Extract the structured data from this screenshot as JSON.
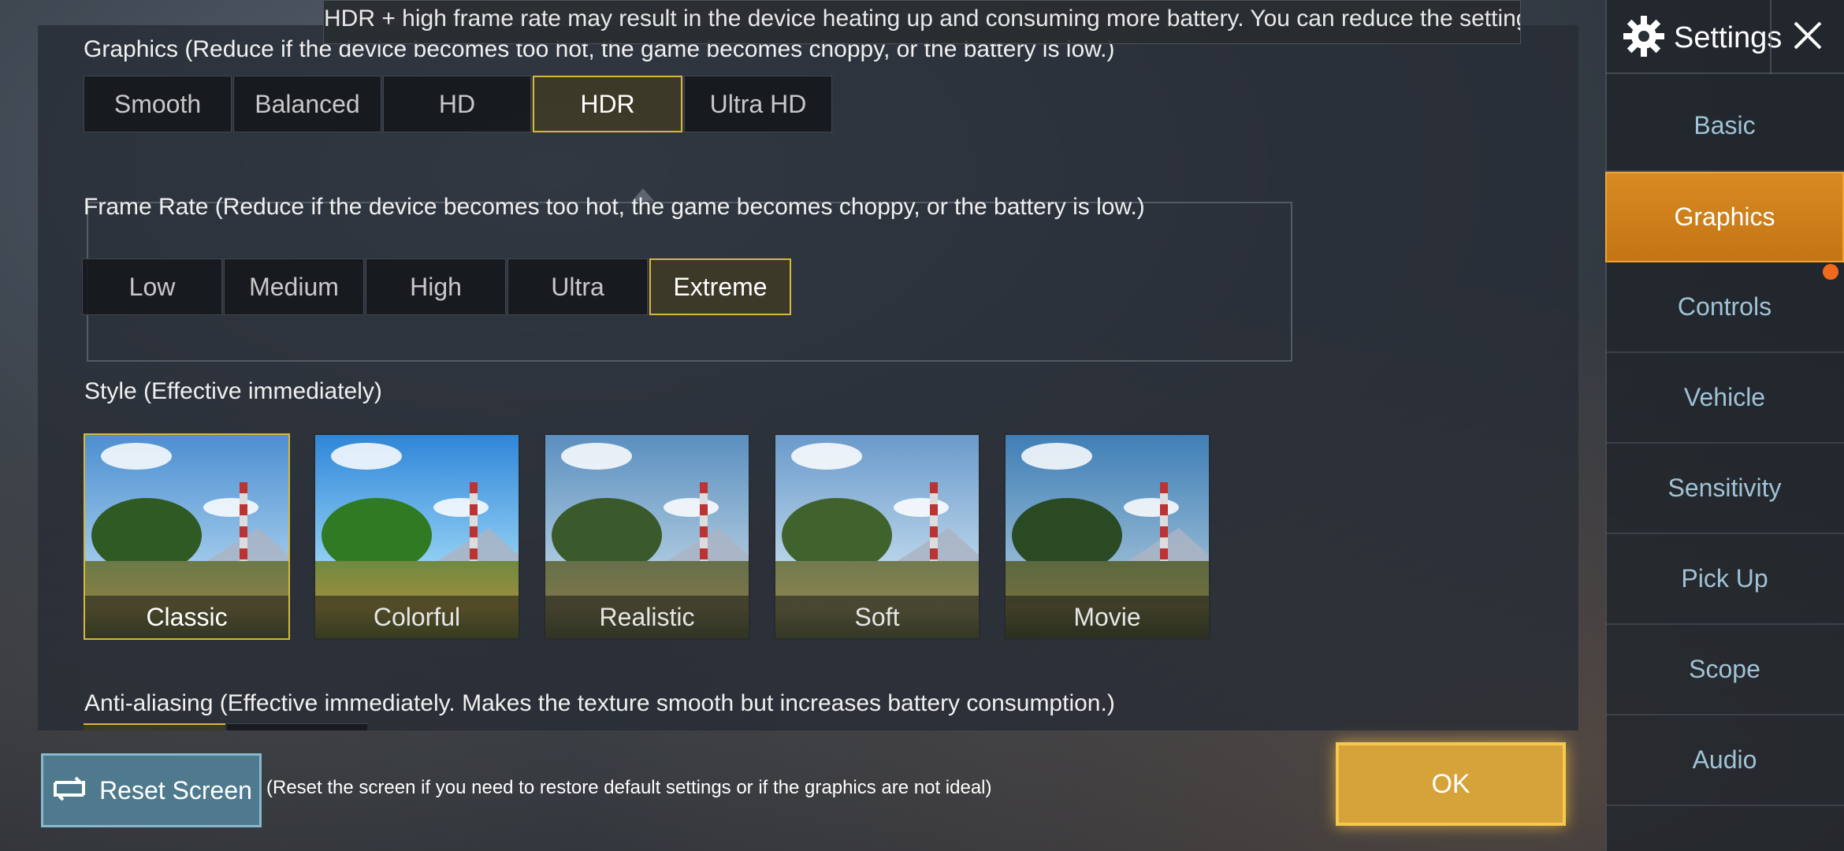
{
  "tooltip": "HDR + high frame rate may result in the device heating up and consuming more battery. You can reduce the settings accordingly.",
  "graphics": {
    "label": "Graphics (Reduce if the device becomes too hot, the game becomes choppy, or the battery is low.)",
    "options": [
      "Smooth",
      "Balanced",
      "HD",
      "HDR",
      "Ultra HD"
    ],
    "selected": "HDR"
  },
  "frame_rate": {
    "label": "Frame Rate (Reduce if the device becomes too hot, the game becomes choppy, or the battery is low.)",
    "options": [
      "Low",
      "Medium",
      "High",
      "Ultra",
      "Extreme"
    ],
    "selected": "Extreme"
  },
  "style": {
    "label": "Style (Effective immediately)",
    "options": [
      "Classic",
      "Colorful",
      "Realistic",
      "Soft",
      "Movie"
    ],
    "selected": "Classic"
  },
  "anti_aliasing": {
    "label": "Anti-aliasing (Effective immediately. Makes the texture smooth but increases battery consumption.)"
  },
  "bottom": {
    "reset_label": "Reset Screen",
    "reset_note": "(Reset the screen if you need to restore default settings or if the graphics are not ideal)",
    "ok_label": "OK"
  },
  "sidebar": {
    "title": "Settings",
    "items": [
      {
        "label": "Basic"
      },
      {
        "label": "Graphics"
      },
      {
        "label": "Controls"
      },
      {
        "label": "Vehicle"
      },
      {
        "label": "Sensitivity"
      },
      {
        "label": "Pick Up"
      },
      {
        "label": "Scope"
      },
      {
        "label": "Audio"
      }
    ],
    "active": "Graphics"
  },
  "colors": {
    "accent_gold": "#d7b83a",
    "nav_active": "#d88a22",
    "nav_text": "#9fc3d6",
    "reset_button": "#4f7a8e",
    "ok_button": "#d6a23a",
    "notification": "#f06a1e"
  },
  "icons": {
    "settings": "gear-icon",
    "close": "close-icon",
    "reset": "reset-screen-icon"
  }
}
